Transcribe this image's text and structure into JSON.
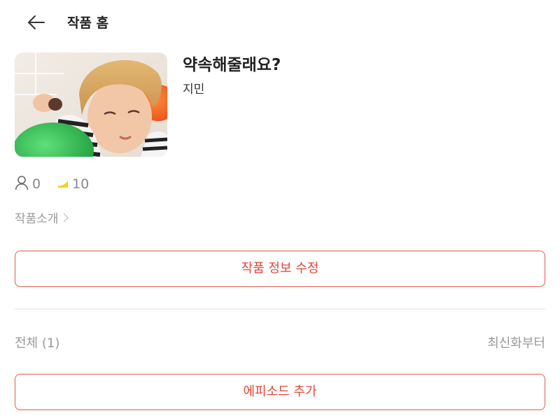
{
  "header": {
    "title": "작품 홈",
    "back_icon": "back-arrow-icon"
  },
  "work": {
    "title": "약속해줄래요?",
    "author": "지민",
    "cover_alt": "cover-image"
  },
  "stats": {
    "subscribers": "0",
    "subscribers_icon": "person-icon",
    "rating": "10",
    "rating_icon": "rating-icon"
  },
  "intro": {
    "label": "작품소개",
    "icon": "chevron-right-icon"
  },
  "actions": {
    "edit_label": "작품 정보 수정",
    "add_episode_label": "에피소드 추가"
  },
  "episodes": {
    "count_label": "전체 (1)",
    "sort_label": "최신화부터"
  },
  "colors": {
    "accent": "#e0473a",
    "muted_text": "#999999",
    "divider": "#e2e2e2"
  }
}
